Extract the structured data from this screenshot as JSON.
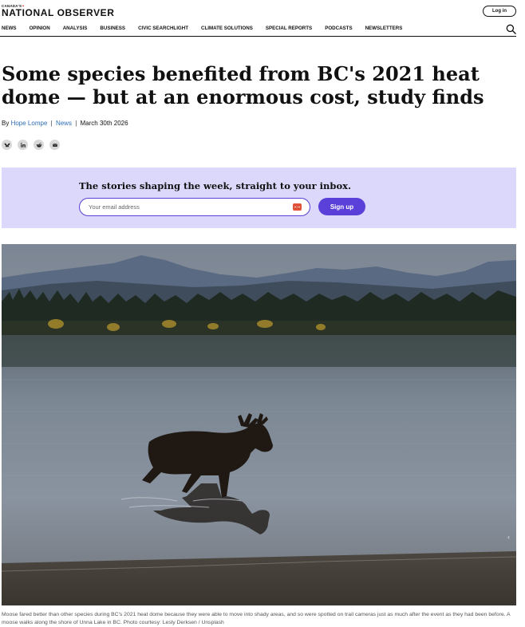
{
  "header": {
    "logo_small": "CANADA'S",
    "logo_main": "NATIONAL OBSERVER",
    "login_label": "Log in"
  },
  "nav": {
    "items": [
      "NEWS",
      "OPINION",
      "ANALYSIS",
      "BUSINESS",
      "CIVIC SEARCHLIGHT",
      "CLIMATE SOLUTIONS",
      "SPECIAL REPORTS",
      "PODCASTS",
      "NEWSLETTERS"
    ]
  },
  "article": {
    "headline": "Some species benefited from BC's 2021 heat dome — but at an enormous cost, study finds",
    "byline_prefix": "By",
    "author": "Hope Lompe",
    "section": "News",
    "date": "March 30th 2026",
    "caption": "Moose fared better than other species during BC's 2021 heat dome because they were able to move into shady areas, and so were spotted on trail cameras just as much after the event as they had been before. A moose walks along the shore of Unna Lake in BC. Photo courtesy: Lesly Derksen / Unsplash"
  },
  "share": {
    "icons": [
      "bluesky-icon",
      "linkedin-icon",
      "reddit-icon",
      "email-icon"
    ]
  },
  "newsletter": {
    "title": "The stories shaping the week, straight to your inbox.",
    "placeholder": "Your email address",
    "signup_label": "Sign up"
  },
  "colors": {
    "accent": "#5a3fd8",
    "newsletter_bg": "#dcd8fb",
    "link": "#2f6fb5"
  }
}
